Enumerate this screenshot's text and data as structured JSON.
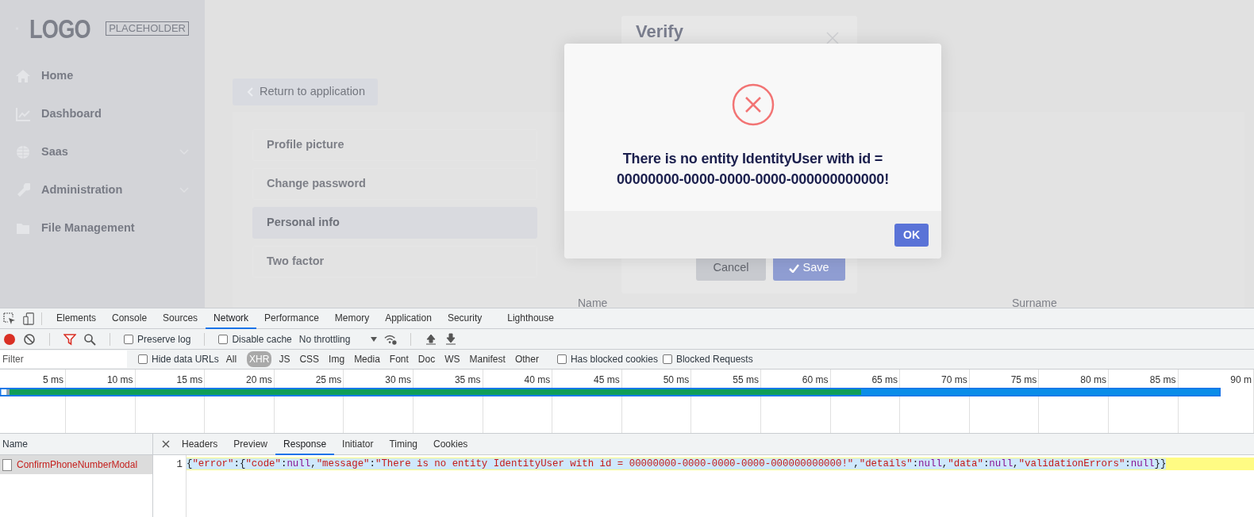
{
  "app": {
    "logo": {
      "word": "LOGO",
      "tag": "PLACEHOLDER"
    },
    "menu": [
      {
        "label": "Home",
        "expandable": false
      },
      {
        "label": "Dashboard",
        "expandable": false
      },
      {
        "label": "Saas",
        "expandable": true
      },
      {
        "label": "Administration",
        "expandable": true
      },
      {
        "label": "File Management",
        "expandable": false
      }
    ],
    "return_button": "Return to application",
    "settings_tabs": [
      {
        "label": "Profile picture",
        "selected": false
      },
      {
        "label": "Change password",
        "selected": false
      },
      {
        "label": "Personal info",
        "selected": true
      },
      {
        "label": "Two factor",
        "selected": false
      }
    ],
    "form_labels": [
      "Name",
      "Surname"
    ]
  },
  "verify_modal": {
    "title": "Verify",
    "buttons": [
      {
        "label": "Cancel",
        "kind": "secondary"
      },
      {
        "label": "Save",
        "kind": "primary"
      }
    ]
  },
  "error_dialog": {
    "message": "There is no entity IdentityUser with id =\n00000000-0000-0000-0000-000000000000!",
    "button": "OK"
  },
  "devtools": {
    "tabs": [
      {
        "label": "Elements",
        "selected": false
      },
      {
        "label": "Console",
        "selected": false
      },
      {
        "label": "Sources",
        "selected": false
      },
      {
        "label": "Network",
        "selected": true
      },
      {
        "label": "Performance",
        "selected": false
      },
      {
        "label": "Memory",
        "selected": false
      },
      {
        "label": "Application",
        "selected": false
      },
      {
        "label": "Security",
        "selected": false
      },
      {
        "label": "Lighthouse",
        "selected": false
      }
    ],
    "toolbar": {
      "recording": true,
      "filter_active": true,
      "preserve_log": {
        "label": "Preserve log",
        "checked": false
      },
      "disable_cache": {
        "label": "Disable cache",
        "checked": false
      },
      "throttling": "No throttling"
    },
    "filter_bar": {
      "placeholder": "Filter",
      "hide_data_urls": {
        "label": "Hide data URLs",
        "checked": false
      },
      "types": [
        {
          "label": "All",
          "selected": false
        },
        {
          "label": "XHR",
          "selected": true
        },
        {
          "label": "JS",
          "selected": false
        },
        {
          "label": "CSS",
          "selected": false
        },
        {
          "label": "Img",
          "selected": false
        },
        {
          "label": "Media",
          "selected": false
        },
        {
          "label": "Font",
          "selected": false
        },
        {
          "label": "Doc",
          "selected": false
        },
        {
          "label": "WS",
          "selected": false
        },
        {
          "label": "Manifest",
          "selected": false
        },
        {
          "label": "Other",
          "selected": false
        }
      ],
      "has_blocked_cookies": {
        "label": "Has blocked cookies",
        "checked": false
      },
      "blocked_requests": {
        "label": "Blocked Requests",
        "checked": false
      }
    },
    "timeline": {
      "ticks": [
        "5 ms",
        "10 ms",
        "15 ms",
        "20 ms",
        "25 ms",
        "30 ms",
        "35 ms",
        "40 ms",
        "45 ms",
        "50 ms",
        "55 ms",
        "60 ms",
        "65 ms",
        "70 ms",
        "75 ms",
        "80 ms",
        "85 ms",
        "90 m"
      ]
    },
    "requests": {
      "header": "Name",
      "rows": [
        {
          "name": "ConfirmPhoneNumberModal",
          "failed": true,
          "selected": true
        }
      ]
    },
    "detail_tabs": [
      {
        "label": "Headers",
        "selected": false
      },
      {
        "label": "Preview",
        "selected": false
      },
      {
        "label": "Response",
        "selected": true
      },
      {
        "label": "Initiator",
        "selected": false
      },
      {
        "label": "Timing",
        "selected": false
      },
      {
        "label": "Cookies",
        "selected": false
      }
    ],
    "response": {
      "line_number": "1",
      "tokens": [
        {
          "kind": "punct",
          "text": "{"
        },
        {
          "kind": "string",
          "text": "\"error\""
        },
        {
          "kind": "punct",
          "text": ":{"
        },
        {
          "kind": "string",
          "text": "\"code\""
        },
        {
          "kind": "punct",
          "text": ":"
        },
        {
          "kind": "null",
          "text": "null"
        },
        {
          "kind": "punct",
          "text": ","
        },
        {
          "kind": "string",
          "text": "\"message\""
        },
        {
          "kind": "punct",
          "text": ":"
        },
        {
          "kind": "string",
          "text": "\"There is no entity IdentityUser with id = 00000000-0000-0000-0000-000000000000!\""
        },
        {
          "kind": "punct",
          "text": ","
        },
        {
          "kind": "string",
          "text": "\"details\""
        },
        {
          "kind": "punct",
          "text": ":"
        },
        {
          "kind": "null",
          "text": "null"
        },
        {
          "kind": "punct",
          "text": ","
        },
        {
          "kind": "string",
          "text": "\"data\""
        },
        {
          "kind": "punct",
          "text": ":"
        },
        {
          "kind": "null",
          "text": "null"
        },
        {
          "kind": "punct",
          "text": ","
        },
        {
          "kind": "string",
          "text": "\"validationErrors\""
        },
        {
          "kind": "punct",
          "text": ":"
        },
        {
          "kind": "null",
          "text": "null"
        },
        {
          "kind": "punct",
          "text": "}}"
        }
      ]
    }
  }
}
